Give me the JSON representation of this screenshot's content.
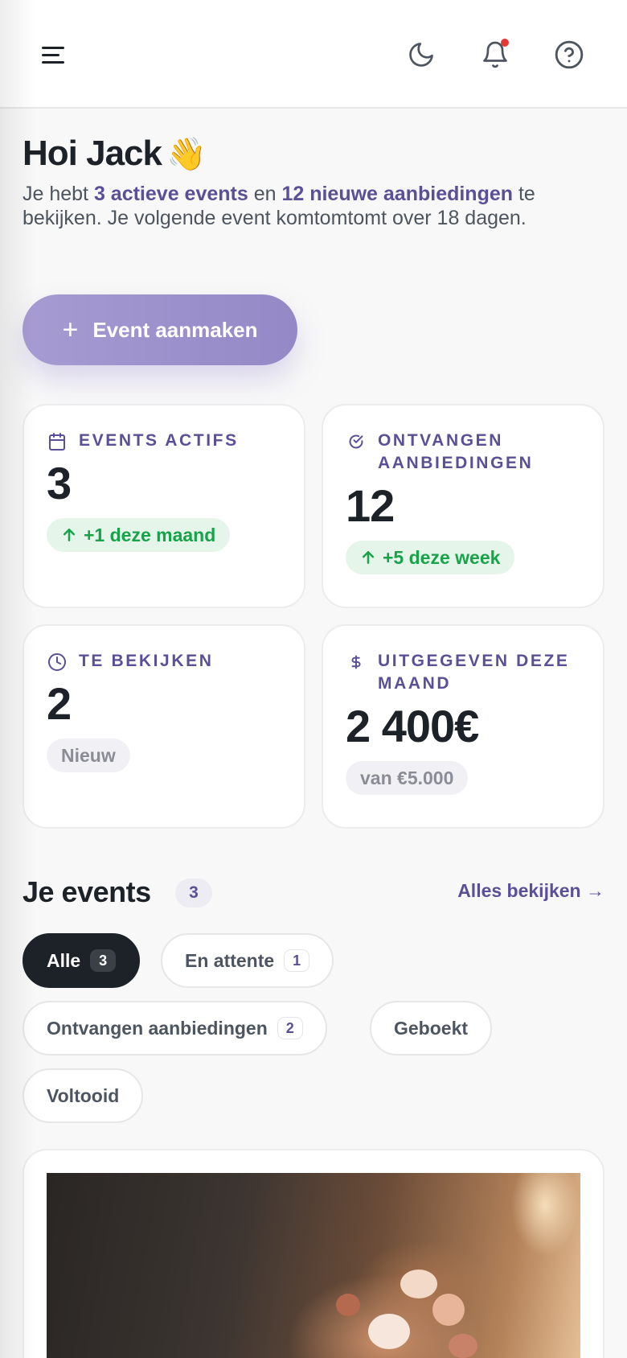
{
  "header": {
    "menu_icon": "hamburger-menu-icon",
    "icons": [
      "moon-icon",
      "bell-icon",
      "help-circle-icon"
    ],
    "notification_dot": true
  },
  "greeting": {
    "title": "Hoi Jack",
    "emoji": "👋",
    "text_1": "Je hebt ",
    "active_events": "3 actieve events",
    "text_2": " en ",
    "new_offers": "12 nieuwe aanbiedingen",
    "text_3": " te bekijken. Je volgende event komtomtomt over 18 dagen."
  },
  "cta": {
    "plus": "+",
    "label": "Event aanmaken"
  },
  "stats": [
    {
      "icon": "calendar-icon",
      "label": "EVENTS ACTIFS",
      "value": "3",
      "badge": "+1 deze maand",
      "badge_type": "green"
    },
    {
      "icon": "check-circle-icon",
      "label": "ONTVANGEN AANBIEDINGEN",
      "value": "12",
      "badge": "+5 deze week",
      "badge_type": "green"
    },
    {
      "icon": "clock-icon",
      "label": "TE BEKIJKEN",
      "value": "2",
      "badge": "Nieuw",
      "badge_type": "grey"
    },
    {
      "icon": "dollar-icon",
      "label": "UITGEGEVEN DEZE MAAND",
      "value": "2 400€",
      "badge": "van €5.000",
      "badge_type": "grey"
    }
  ],
  "events": {
    "title": "Je events",
    "count": "3",
    "see_all": "Alles bekijken →",
    "filters": [
      {
        "label": "Alle",
        "count": "3",
        "active": true
      },
      {
        "label": "En attente",
        "count": "1",
        "active": false
      },
      {
        "label": "Ontvangen aanbiedingen",
        "count": "2",
        "active": false
      },
      {
        "label": "Geboekt",
        "count": "",
        "active": false
      },
      {
        "label": "Voltooid",
        "count": "",
        "active": false
      }
    ]
  },
  "colors": {
    "accent": "#5b4f96",
    "cta": "#9c90cb",
    "positive": "#18a24a",
    "dark": "#1c2227"
  }
}
